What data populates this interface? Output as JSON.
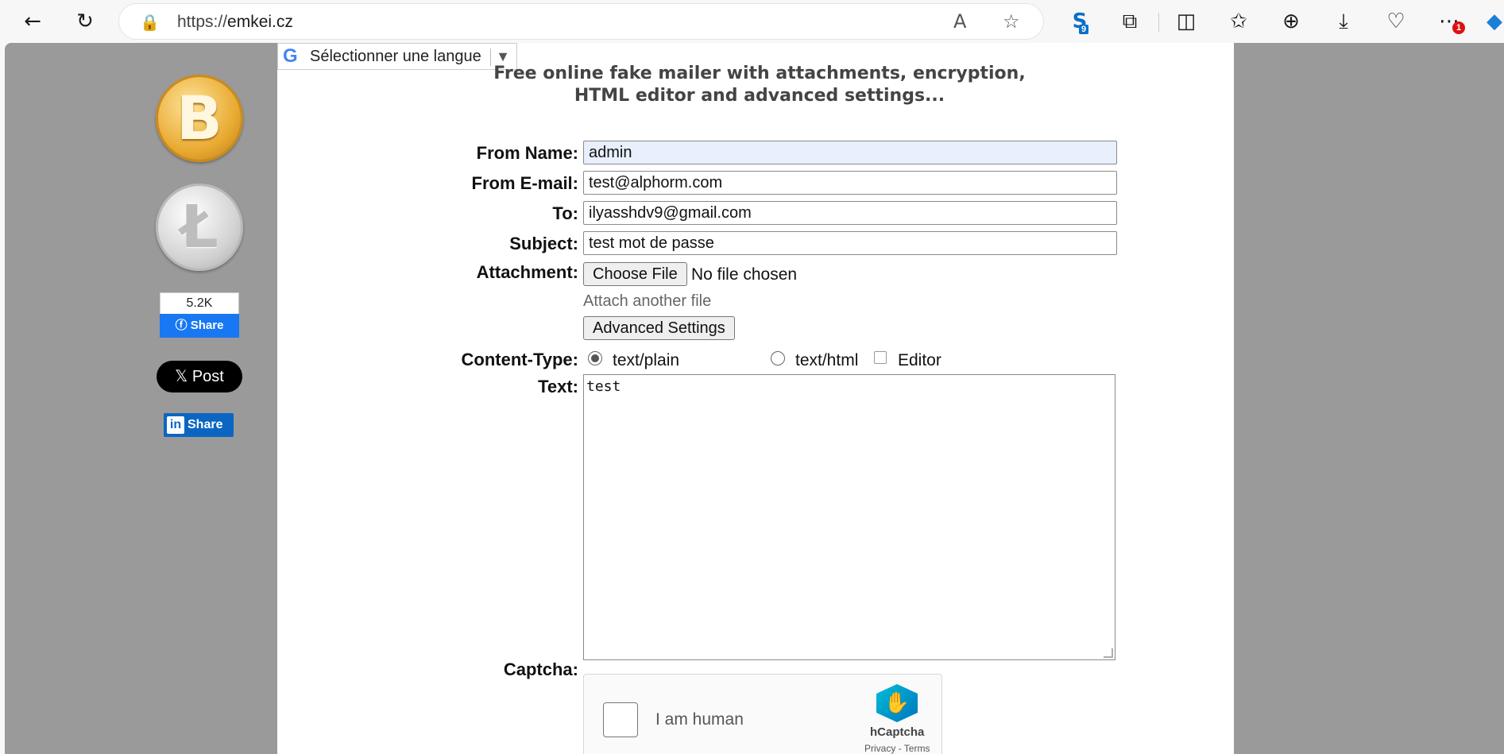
{
  "browser": {
    "url_scheme": "https://",
    "url_host": "emkei.cz",
    "extension_badge": "9",
    "more_badge": "1"
  },
  "language_selector": {
    "label": "Sélectionner une langue",
    "arrow": "▼"
  },
  "page": {
    "title_line1": "Free online fake mailer with attachments, encryption,",
    "title_line2": "HTML editor and advanced settings..."
  },
  "sidebar": {
    "bitcoin_symbol": "B",
    "litecoin_symbol": "Ł",
    "fb_count": "5.2K",
    "fb_share": "Share",
    "x_post": "Post",
    "linkedin_share": "Share"
  },
  "form": {
    "from_name_label": "From Name:",
    "from_name_value": "admin",
    "from_email_label": "From E-mail:",
    "from_email_value": "test@alphorm.com",
    "to_label": "To:",
    "to_value": "ilyasshdv9@gmail.com",
    "subject_label": "Subject:",
    "subject_value": "test mot de passe",
    "attachment_label": "Attachment:",
    "choose_file": "Choose File",
    "no_file": "No file chosen",
    "attach_another": "Attach another file",
    "advanced_settings": "Advanced Settings",
    "content_type_label": "Content-Type:",
    "text_plain": "text/plain",
    "text_html": "text/html",
    "editor": "Editor",
    "text_label": "Text:",
    "text_value": "test",
    "captcha_label": "Captcha:"
  },
  "captcha": {
    "checkbox_text": "I am human",
    "brand": "hCaptcha",
    "links": "Privacy - Terms"
  }
}
